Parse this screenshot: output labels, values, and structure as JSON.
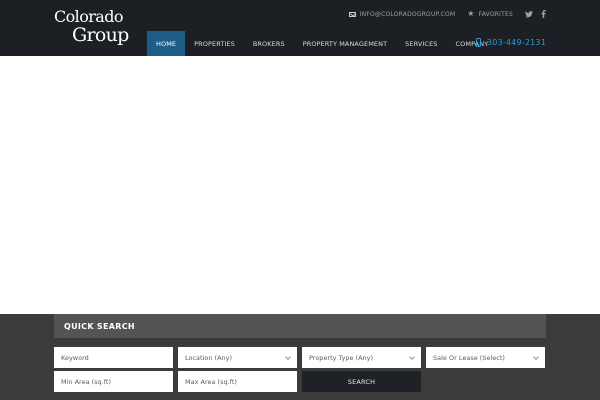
{
  "header": {
    "logo_line1": "Colorado",
    "logo_line2": "Group",
    "email": "INFO@COLORADOGROUP.COM",
    "favorites": "FAVORITES",
    "social_icons": [
      "twitter-icon",
      "facebook-icon"
    ]
  },
  "nav": {
    "items": [
      {
        "label": "HOME",
        "active": true
      },
      {
        "label": "PROPERTIES",
        "active": false
      },
      {
        "label": "BROKERS",
        "active": false
      },
      {
        "label": "PROPERTY MANAGEMENT",
        "active": false
      },
      {
        "label": "SERVICES",
        "active": false
      },
      {
        "label": "COMPANY",
        "active": false
      }
    ],
    "phone": "303-449-2131"
  },
  "search": {
    "title": "QUICK SEARCH",
    "keyword_placeholder": "Keyword",
    "location_value": "Location (Any)",
    "property_type_value": "Property Type (Any)",
    "sale_lease_value": "Sale Or Lease (Select)",
    "min_area_placeholder": "Min Area (sq.ft)",
    "max_area_placeholder": "Max Area (sq.ft)",
    "search_button": "SEARCH"
  },
  "colors": {
    "header_bg": "#1c1f23",
    "nav_active": "#1e5d85",
    "phone_accent": "#2a9bd7",
    "search_bg": "#3b3b3b",
    "search_title_bg": "#545454"
  }
}
